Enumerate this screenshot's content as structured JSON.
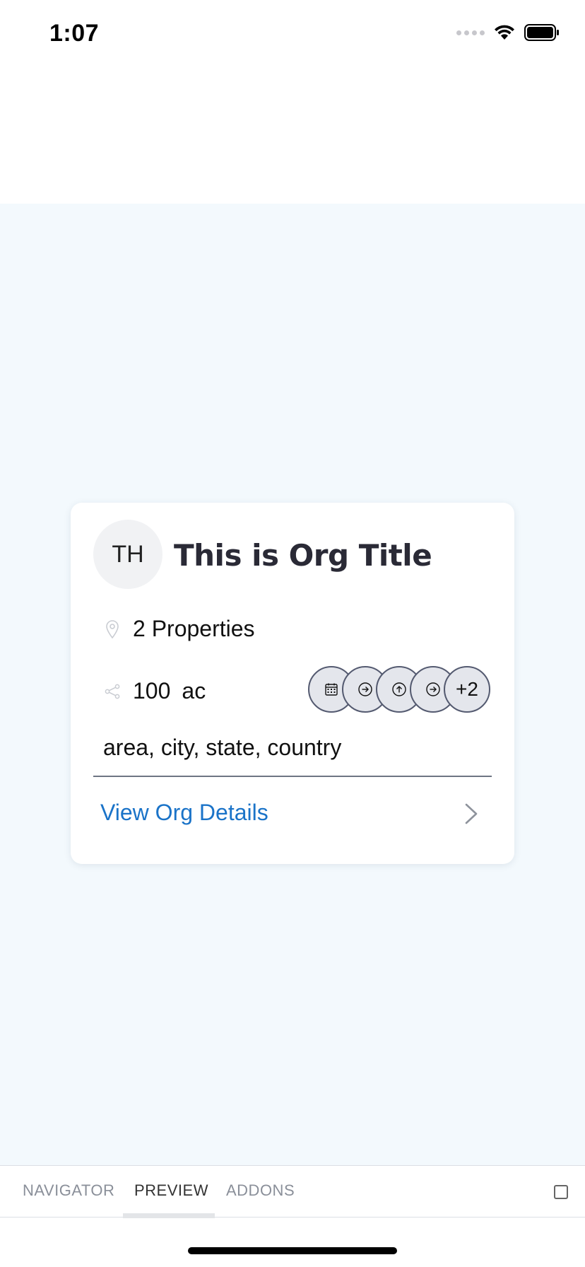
{
  "status_bar": {
    "time": "1:07"
  },
  "card": {
    "avatar_initials": "TH",
    "title": "This is Org Title",
    "properties_text": "2 Properties",
    "area_value": "100",
    "area_unit": "ac",
    "location": "area, city, state, country",
    "view_link": "View Org Details",
    "bubbles": [
      {
        "icon": "calendar-icon"
      },
      {
        "icon": "arrow-right-circle-icon"
      },
      {
        "icon": "arrow-up-circle-icon"
      },
      {
        "icon": "arrow-right-circle-icon"
      },
      {
        "label": "+2"
      }
    ]
  },
  "bottom_bar": {
    "tabs": [
      {
        "label": "NAVIGATOR"
      },
      {
        "label": "PREVIEW"
      },
      {
        "label": "ADDONS"
      }
    ],
    "active_tab": "PREVIEW"
  },
  "colors": {
    "canvas_bg": "#f3f9fd",
    "link": "#1a73c8",
    "bubble_bg": "#e4e6ec",
    "bubble_border": "#545a70"
  }
}
